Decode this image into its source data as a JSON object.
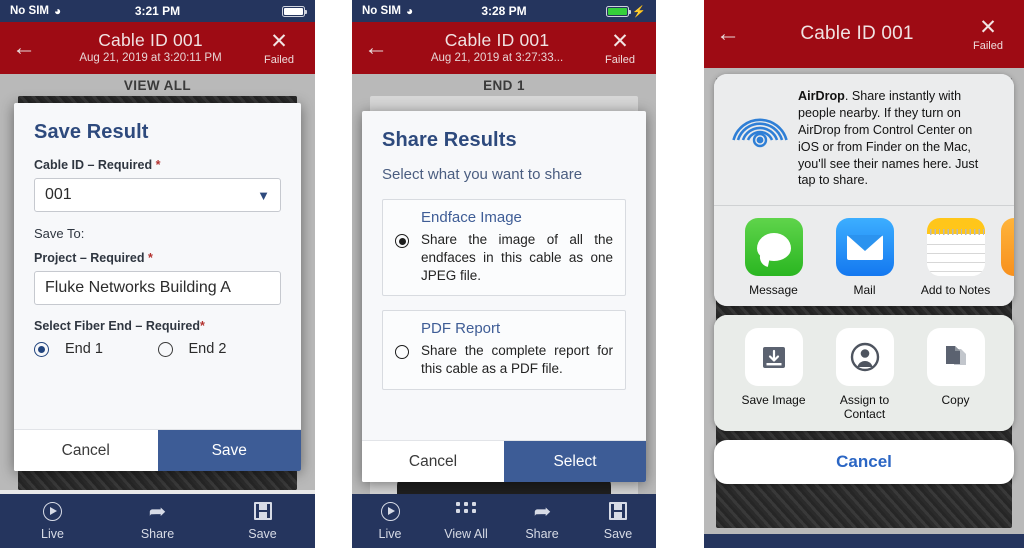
{
  "panel1": {
    "status_bar": {
      "carrier": "No SIM",
      "wifi_icon": "wifi-icon",
      "time": "3:21 PM",
      "battery_icon": "battery-full-icon"
    },
    "header": {
      "back_icon": "back-arrow-icon",
      "title": "Cable ID 001",
      "subtitle": "Aug 21, 2019 at 3:20:11 PM",
      "close_icon": "close-x-icon",
      "status_label": "Failed"
    },
    "background": {
      "section_label": "VIEW ALL"
    },
    "dialog": {
      "title": "Save Result",
      "cable_id_label": "Cable ID – Required",
      "required_mark": "*",
      "cable_id_value": "001",
      "dropdown_icon": "chevron-down-icon",
      "save_to_label": "Save To:",
      "project_label": "Project – Required",
      "project_value": "Fluke Networks Building A",
      "fiber_end_label": "Select Fiber End – Required",
      "end1_label": "End 1",
      "end2_label": "End 2",
      "selected_end": "End 1",
      "cancel_label": "Cancel",
      "confirm_label": "Save"
    },
    "toolbar": [
      {
        "label": "Live",
        "icon": "live-play-icon"
      },
      {
        "label": "Share",
        "icon": "share-arrow-icon"
      },
      {
        "label": "Save",
        "icon": "save-floppy-icon"
      }
    ]
  },
  "panel2": {
    "status_bar": {
      "carrier": "No SIM",
      "wifi_icon": "wifi-icon",
      "time": "3:28 PM",
      "battery_icon": "battery-charging-icon",
      "charging_icon": "bolt-icon"
    },
    "header": {
      "back_icon": "back-arrow-icon",
      "title": "Cable ID 001",
      "subtitle": "Aug 21, 2019 at 3:27:33...",
      "close_icon": "close-x-icon",
      "status_label": "Failed"
    },
    "background": {
      "section_label": "END 1"
    },
    "dialog": {
      "title": "Share Results",
      "subtitle": "Select what you want to share",
      "options": [
        {
          "title": "Endface Image",
          "description": "Share the image of all the endfaces in this cable as one JPEG file.",
          "selected": true
        },
        {
          "title": "PDF Report",
          "description": "Share the complete report for this cable as a PDF file.",
          "selected": false
        }
      ],
      "cancel_label": "Cancel",
      "confirm_label": "Select"
    },
    "toolbar": [
      {
        "label": "Live",
        "icon": "live-play-icon"
      },
      {
        "label": "View All",
        "icon": "grid-dots-icon"
      },
      {
        "label": "Share",
        "icon": "share-arrow-icon"
      },
      {
        "label": "Save",
        "icon": "save-floppy-icon"
      }
    ]
  },
  "panel3": {
    "header": {
      "back_icon": "back-arrow-icon",
      "title": "Cable ID 001",
      "close_icon": "close-x-icon",
      "status_label": "Failed"
    },
    "share_sheet": {
      "airdrop": {
        "icon": "airdrop-icon",
        "name": "AirDrop",
        "text": ". Share instantly with people nearby. If they turn on AirDrop from Control Center on iOS or from Finder on the Mac, you'll see their names here. Just tap to share."
      },
      "apps": [
        {
          "label": "Message",
          "icon": "messages-app-icon"
        },
        {
          "label": "Mail",
          "icon": "mail-app-icon"
        },
        {
          "label": "Add to Notes",
          "icon": "notes-app-icon"
        },
        {
          "label": "",
          "icon": "partial-app-icon"
        }
      ],
      "actions": [
        {
          "label": "Save Image",
          "icon": "save-image-icon"
        },
        {
          "label": "Assign to Contact",
          "icon": "assign-contact-icon"
        },
        {
          "label": "Copy",
          "icon": "copy-icon"
        }
      ],
      "cancel_label": "Cancel"
    }
  },
  "colors": {
    "app_red": "#9e0b14",
    "navy": "#25355e",
    "primary_blue": "#3d5c96",
    "dialog_title_blue": "#2e4a7d",
    "required_red": "#b3322f",
    "ios_blue": "#2b66c4"
  }
}
